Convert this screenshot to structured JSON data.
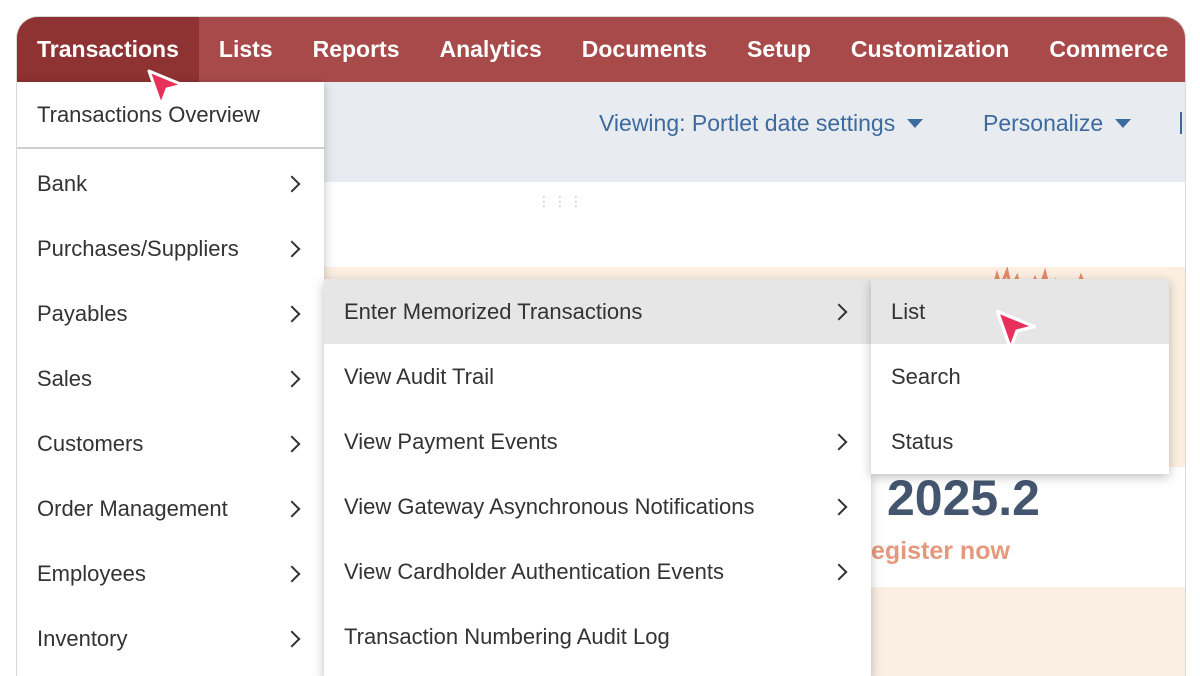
{
  "topnav": {
    "items": [
      "Transactions",
      "Lists",
      "Reports",
      "Analytics",
      "Documents",
      "Setup",
      "Customization",
      "Commerce"
    ]
  },
  "subbar": {
    "viewing_label": "Viewing: Portlet date settings",
    "personalize_label": "Personalize"
  },
  "transactions_menu": {
    "overview": "Transactions Overview",
    "items": [
      "Bank",
      "Purchases/Suppliers",
      "Payables",
      "Sales",
      "Customers",
      "Order Management",
      "Employees",
      "Inventory"
    ]
  },
  "payables_submenu": {
    "items": [
      "Enter Memorized Transactions",
      "View Audit Trail",
      "View Payment Events",
      "View Gateway Asynchronous Notifications",
      "View Cardholder Authentication Events",
      "Transaction Numbering Audit Log"
    ]
  },
  "memorized_submenu": {
    "items": [
      "List",
      "Search",
      "Status"
    ]
  },
  "banner": {
    "version_fragment": "2025.2",
    "register_fragment": "egister now"
  },
  "colors": {
    "nav_bg": "#a84a4a",
    "nav_active": "#8e3232",
    "link_blue": "#3d6a9e",
    "cursor": "#e8315a"
  }
}
